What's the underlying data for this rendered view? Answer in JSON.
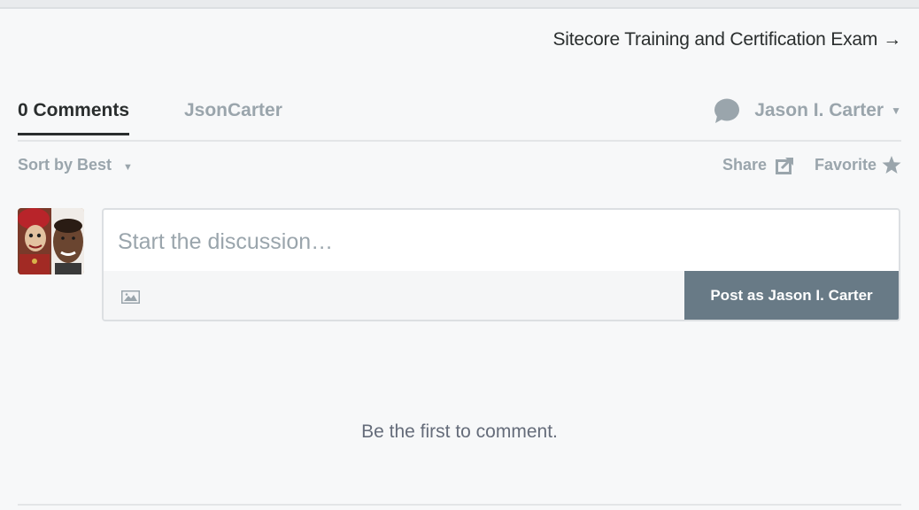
{
  "header": {
    "next_link": "Sitecore Training and Certification Exam",
    "next_arrow": "→"
  },
  "tabs": {
    "comments": "0 Comments",
    "community": "JsonCarter"
  },
  "user": {
    "name": "Jason I. Carter",
    "caret": "▼"
  },
  "sort": {
    "label": "Sort by Best",
    "caret": "▼"
  },
  "actions": {
    "share": "Share",
    "favorite": "Favorite"
  },
  "composer": {
    "placeholder": "Start the discussion…",
    "post_button": "Post as Jason I. Carter"
  },
  "empty_state": "Be the first to comment.",
  "colors": {
    "primary_text": "#2a2e2e",
    "muted_text": "#9aa5ac",
    "button_bg": "#687a86",
    "background": "#f7f8f9"
  },
  "icons": [
    "chat-bubble-icon",
    "share-icon",
    "star-icon",
    "image-icon",
    "caret-down-icon"
  ]
}
